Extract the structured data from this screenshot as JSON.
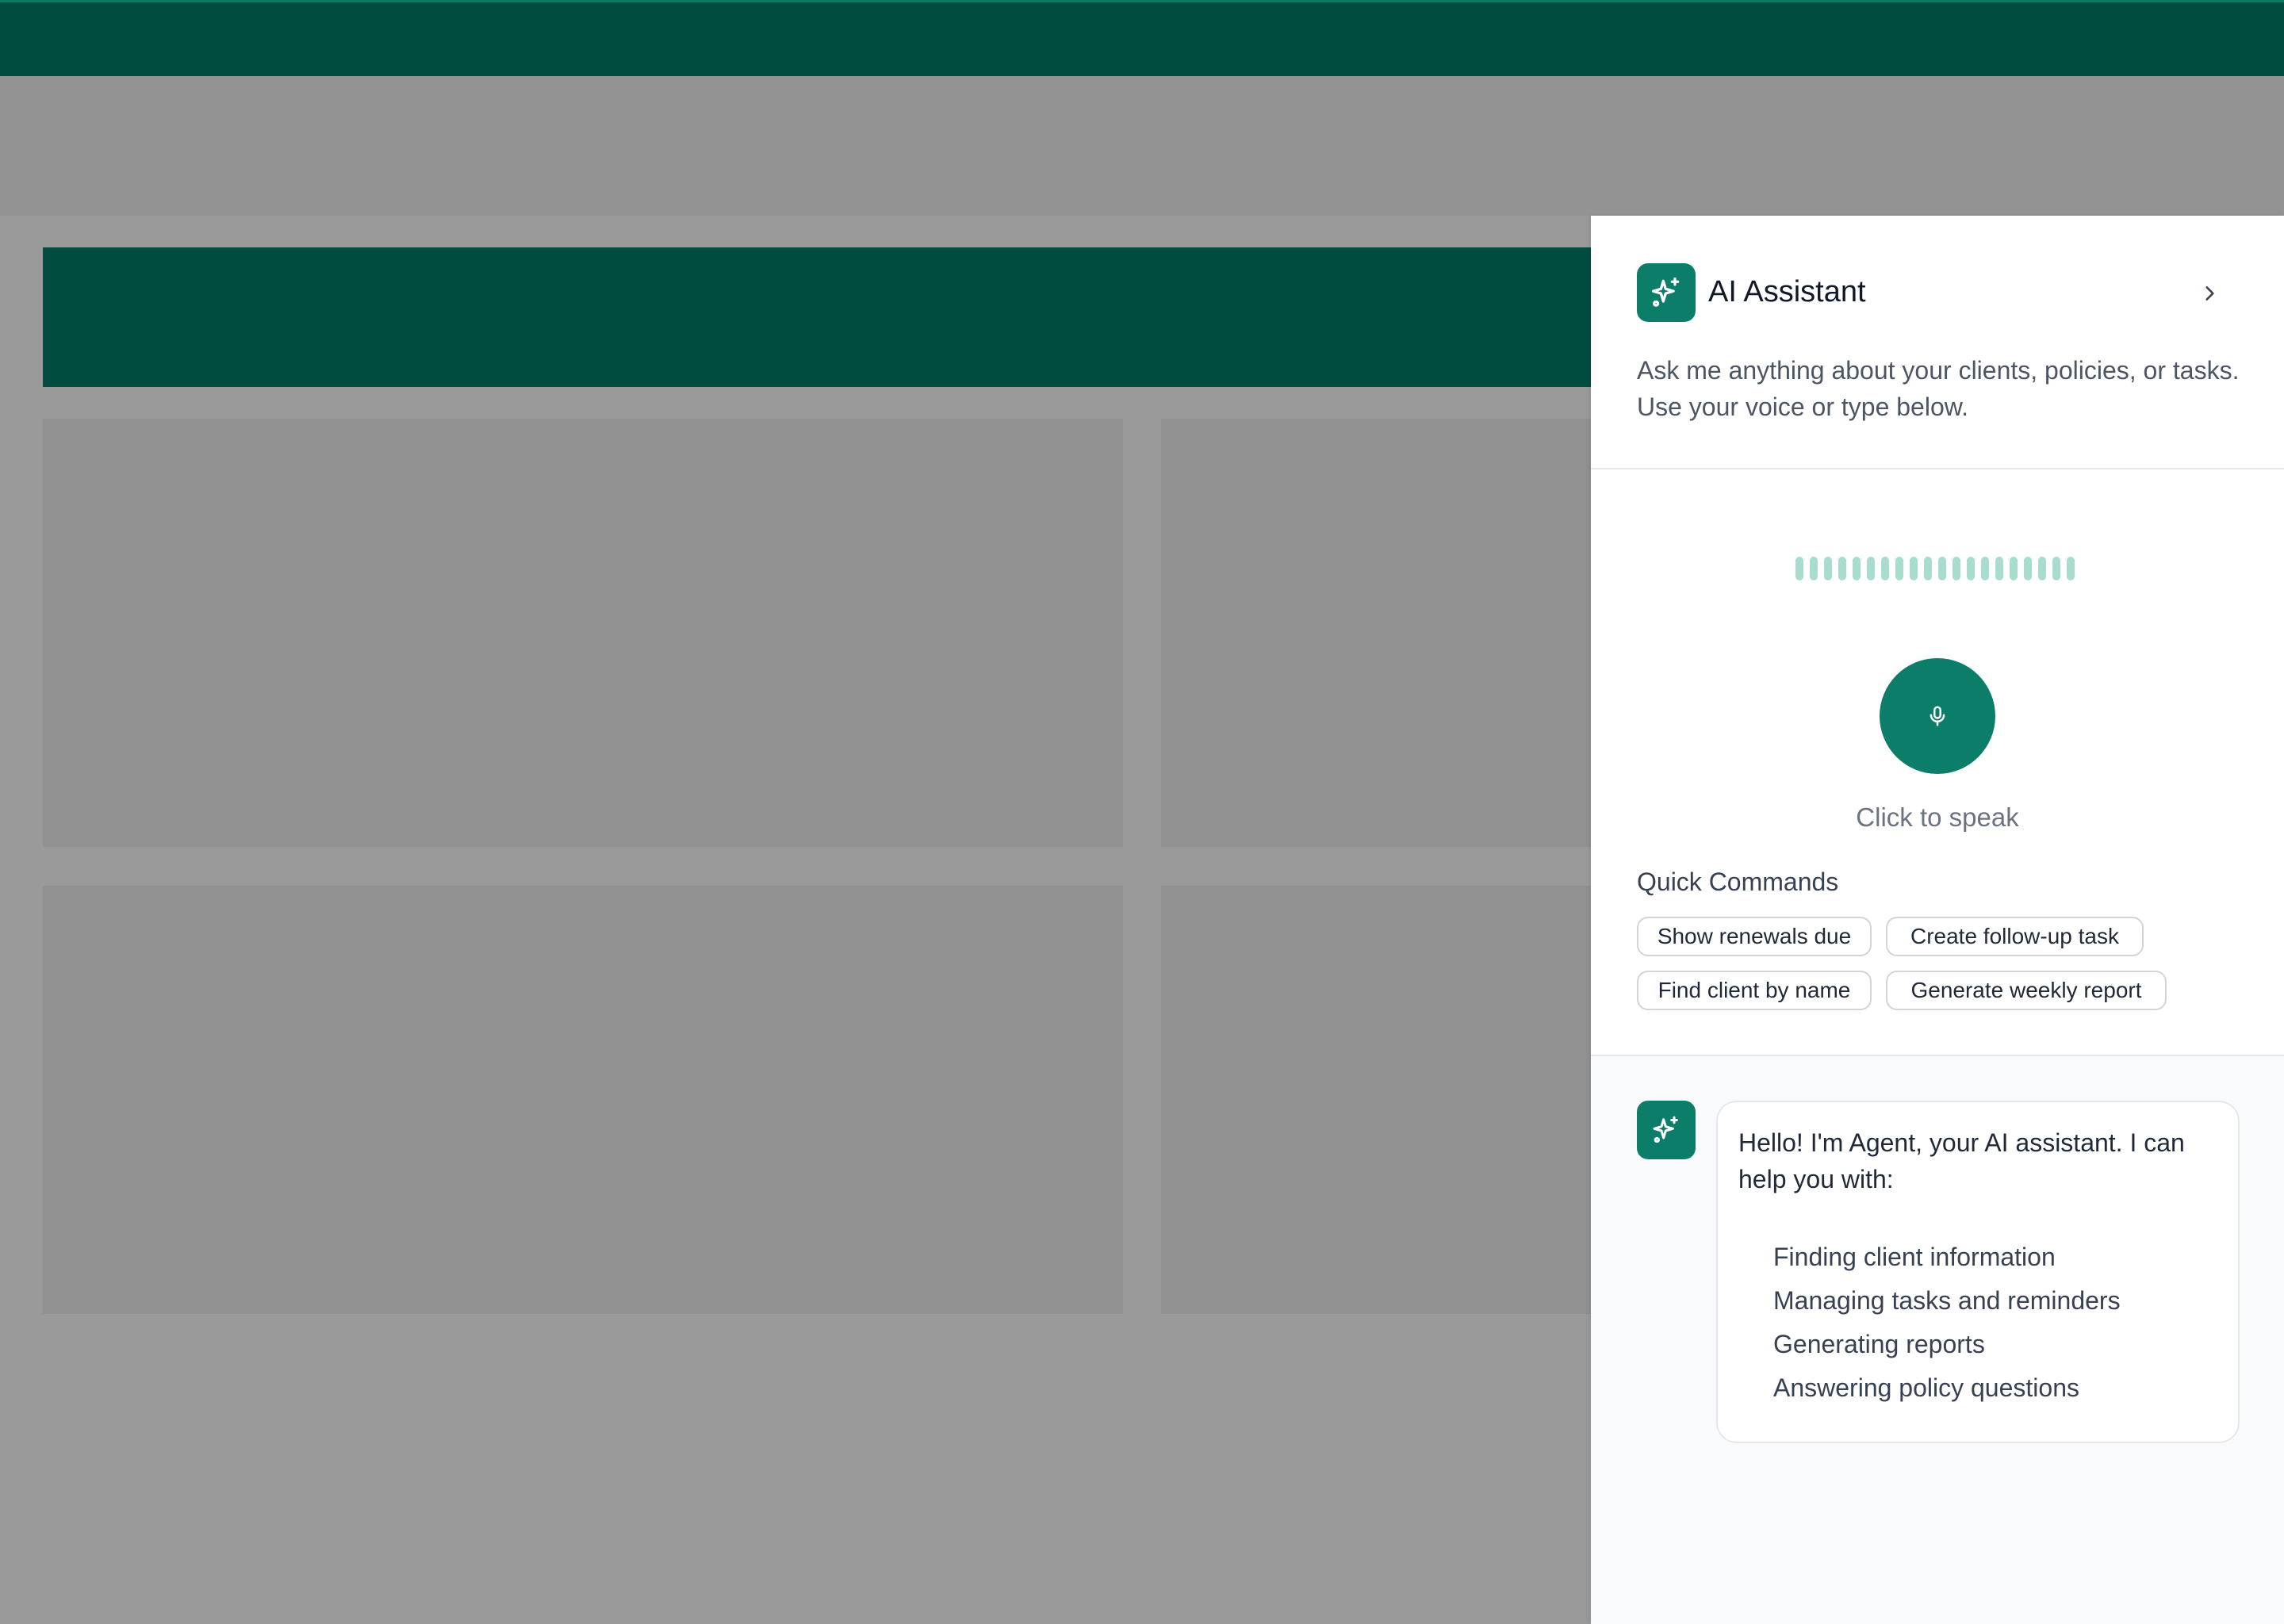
{
  "assistant": {
    "title": "AI Assistant",
    "description": "Ask me anything about your clients, policies, or tasks. Use your voice or type below.",
    "icon": "sparkles-icon",
    "collapse_icon": "chevron-right-icon",
    "accent_color": "#0b7d68",
    "voice": {
      "prompt": "Click to speak",
      "mic_icon": "microphone-icon",
      "waveform_bars": 20,
      "waveform_color": "#a8dccf"
    },
    "quick_commands": {
      "title": "Quick Commands",
      "items": [
        "Show renewals due",
        "Create follow-up task",
        "Find client by name",
        "Generate weekly report"
      ]
    },
    "message": {
      "intro": "Hello! I'm Agent, your AI assistant. I can help you with:",
      "items": [
        "Finding client information",
        "Managing tasks and reminders",
        "Generating reports",
        "Answering policy questions"
      ]
    }
  },
  "background": {
    "top_bar_color": "#004d40",
    "overlay_color": "#9a9a9a"
  }
}
